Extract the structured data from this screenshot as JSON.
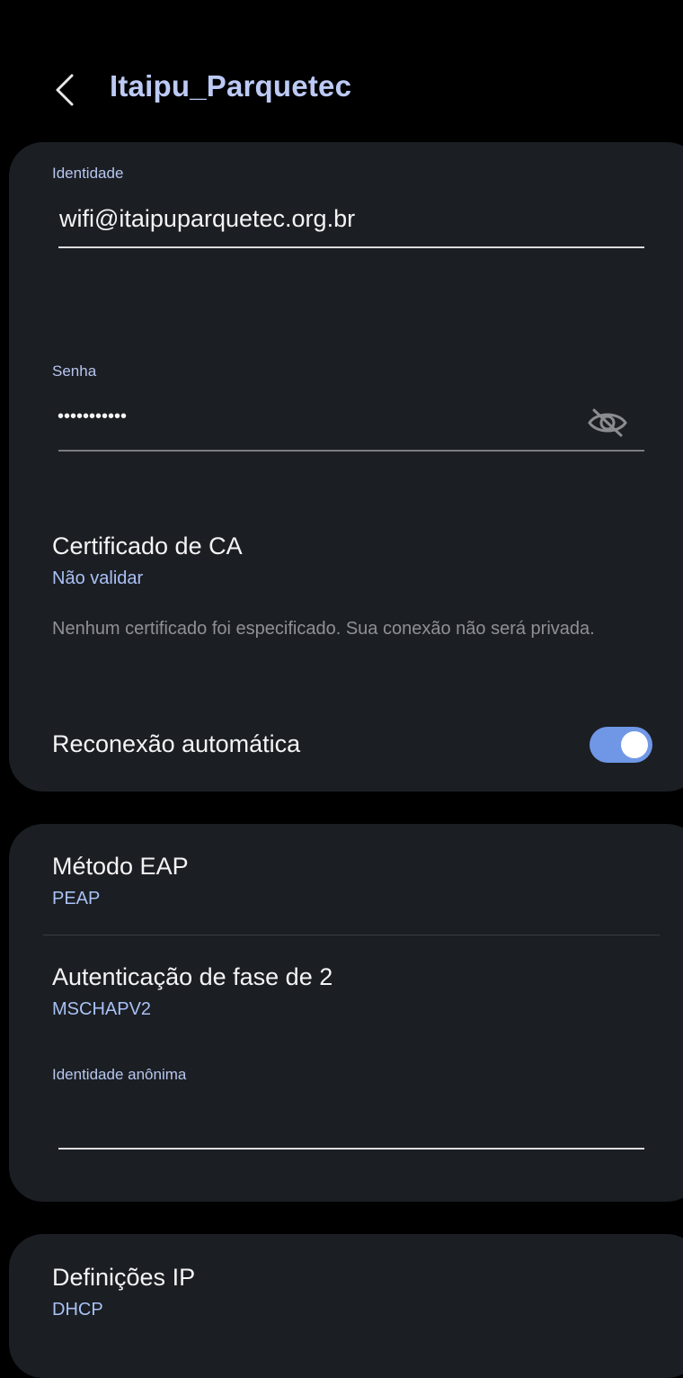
{
  "header": {
    "title": "Itaipu_Parquetec"
  },
  "identity": {
    "label": "Identidade",
    "value": "wifi@itaipuparquetec.org.br"
  },
  "password": {
    "label": "Senha",
    "value": "•••••••••••"
  },
  "ca_certificate": {
    "title": "Certificado de CA",
    "value": "Não validar",
    "warning": "Nenhum certificado foi especificado. Sua conexão não será privada."
  },
  "auto_reconnect": {
    "label": "Reconexão automática",
    "enabled": true
  },
  "eap_method": {
    "title": "Método EAP",
    "value": "PEAP"
  },
  "phase2_auth": {
    "title": "Autenticação de fase de 2",
    "value": "MSCHAPV2"
  },
  "anonymous_identity": {
    "label": "Identidade anônima",
    "value": ""
  },
  "ip_settings": {
    "title": "Definições IP",
    "value": "DHCP"
  },
  "colors": {
    "accent": "#7097e6",
    "title": "#bccaf5",
    "card": "#1b1e23",
    "background": "#000000"
  },
  "icons": {
    "back": "chevron-left-icon",
    "visibility": "eye-off-icon"
  }
}
